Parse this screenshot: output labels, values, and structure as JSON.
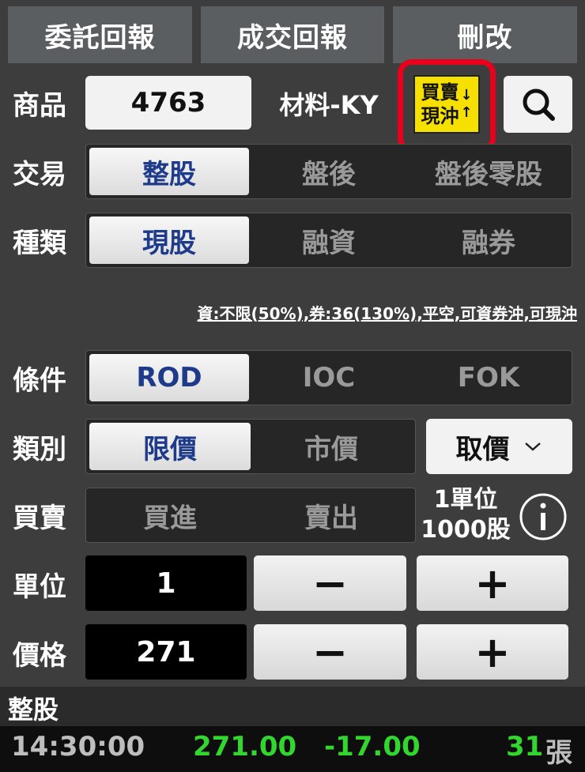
{
  "tabs": [
    "委託回報",
    "成交回報",
    "刪改"
  ],
  "product": {
    "label": "商品",
    "code": "4763",
    "name": "材料-KY",
    "daytrade_badge_top": "買賣",
    "daytrade_badge_bottom": "現沖",
    "search_icon": "search-icon"
  },
  "trade": {
    "label": "交易",
    "options": [
      "整股",
      "盤後",
      "盤後零股"
    ],
    "selected": 0
  },
  "kind": {
    "label": "種類",
    "options": [
      "現股",
      "融資",
      "融券"
    ],
    "selected": 0
  },
  "note": "資:不限(50%),券:36(130%),平空,可資券沖,可現沖",
  "condition": {
    "label": "條件",
    "options": [
      "ROD",
      "IOC",
      "FOK"
    ],
    "selected": 0
  },
  "price_type": {
    "label": "類別",
    "options": [
      "限價",
      "市價"
    ],
    "selected": 0,
    "dropdown": "取價"
  },
  "side": {
    "label": "買賣",
    "options": [
      "買進",
      "賣出"
    ],
    "unit_line1": "1單位",
    "unit_line2": "1000股"
  },
  "unit": {
    "label": "單位",
    "value": "1",
    "minus": "−",
    "plus": "+"
  },
  "price": {
    "label": "價格",
    "value": "271",
    "minus": "−",
    "plus": "+"
  },
  "footer": {
    "title": "整股",
    "time": "14:30:00",
    "price": "271.00",
    "change": "-17.00",
    "qty": "31",
    "qty_unit": "張"
  },
  "colors": {
    "highlight": "#e8001c",
    "badge": "#f5e000",
    "up": "#33d62f",
    "selected_text": "#1e3a8a"
  }
}
